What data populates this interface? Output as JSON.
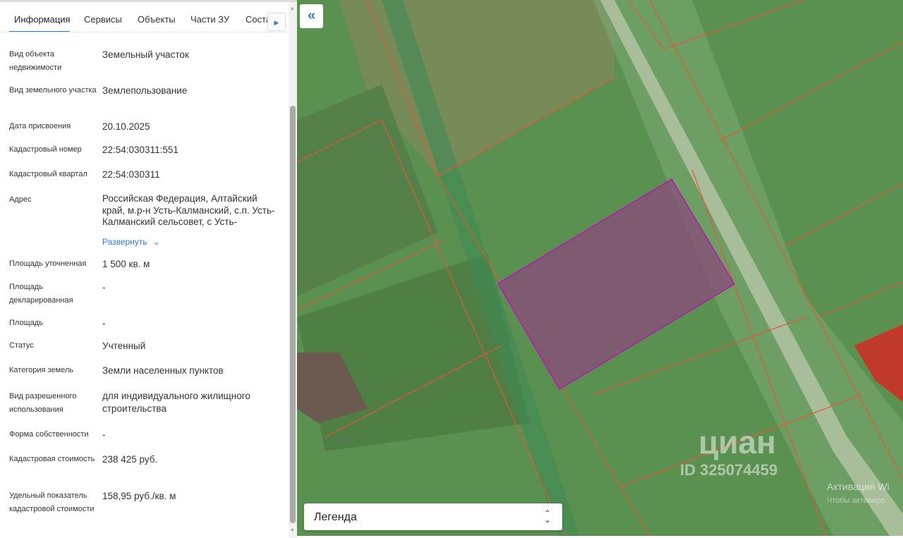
{
  "tabs": [
    "Информация",
    "Сервисы",
    "Объекты",
    "Части ЗУ",
    "Состав"
  ],
  "fields": [
    {
      "label": "Вид объекта недвижимости",
      "value": "Земельный участок"
    },
    {
      "label": "Вид земельного участка",
      "value": "Землепользование"
    },
    {
      "label": "Дата присвоения",
      "value": "20.10.2025"
    },
    {
      "label": "Кадастровый номер",
      "value": "22:54:030311:551"
    },
    {
      "label": "Кадастровый квартал",
      "value": "22:54:030311"
    },
    {
      "label": "Адрес",
      "value": "Российская Федерация, Алтайский край, м.р-н Усть-Калманский, с.п. Усть-Калманский сельсовет, с Усть-"
    },
    {
      "label": "Площадь уточненная",
      "value": "1 500 кв. м"
    },
    {
      "label": "Площадь декларированная",
      "value": "-"
    },
    {
      "label": "Площадь",
      "value": "-"
    },
    {
      "label": "Статус",
      "value": "Учтенный"
    },
    {
      "label": "Категория земель",
      "value": "Земли населенных пунктов"
    },
    {
      "label": "Вид разрешенного использования",
      "value": "для индивидуального жилищного строительства"
    },
    {
      "label": "Форма собственности",
      "value": "-"
    },
    {
      "label": "Кадастровая стоимость",
      "value": "238 425 руб."
    },
    {
      "label": "Удельный показатель кадастровой стоимости",
      "value": "158,95 руб./кв. м"
    }
  ],
  "expand_link": "Развернуть",
  "legend": "Легенда",
  "watermark": {
    "brand": "циан",
    "id": "ID 325074459"
  },
  "os_notice": {
    "title": "Активация Wi",
    "sub": "Чтобы активиро"
  },
  "colors": {
    "accent": "#2f7ad1",
    "parcel_border": "#b01ab5",
    "boundary": "#e8553a"
  }
}
